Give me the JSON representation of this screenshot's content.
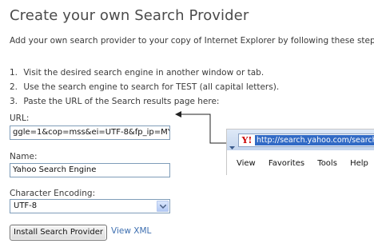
{
  "page": {
    "title": "Create your own Search Provider",
    "intro": "Add your own search provider to your copy of Internet Explorer by following these steps:"
  },
  "steps": [
    {
      "num": "1.",
      "text": "Visit the desired search engine in another window or tab."
    },
    {
      "num": "2.",
      "text": "Use the search engine to search for TEST (all capital letters)."
    },
    {
      "num": "3.",
      "text": "Paste the URL of the Search results page here:"
    }
  ],
  "form": {
    "url_label": "URL:",
    "url_value": "ggle=1&cop=mss&ei=UTF-8&fp_ip=MY",
    "name_label": "Name:",
    "name_value": "Yahoo Search Engine",
    "encoding_label": "Character Encoding:",
    "encoding_value": "UTF-8",
    "install_button": "Install Search Provider",
    "view_xml_link": "View XML"
  },
  "browser_snippet": {
    "favicon_letter": "Y!",
    "address": "http://search.yahoo.com/search?",
    "menu": [
      "View",
      "Favorites",
      "Tools",
      "Help"
    ]
  },
  "colors": {
    "link": "#3e6fb0",
    "url_highlight": "#316ac5",
    "input_border": "#7f9db9"
  }
}
